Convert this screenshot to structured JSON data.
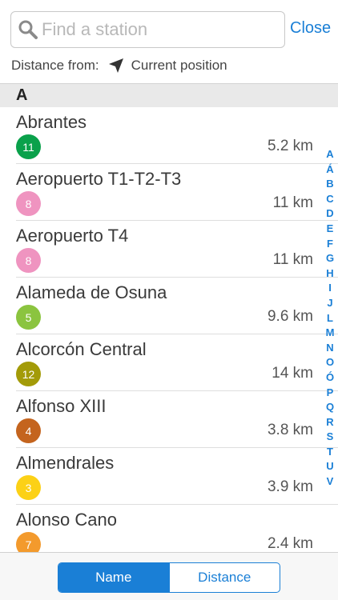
{
  "search": {
    "placeholder": "Find a station",
    "value": "",
    "icon": "search-icon"
  },
  "close_label": "Close",
  "distance_from": {
    "label": "Distance from:",
    "value": "Current position",
    "icon": "location-arrow-icon"
  },
  "section_header": "A",
  "stations": [
    {
      "name": "Abrantes",
      "line": "11",
      "color": "#0aa14b",
      "distance": "5.2 km"
    },
    {
      "name": "Aeropuerto T1-T2-T3",
      "line": "8",
      "color": "#ef94c0",
      "distance": "11 km"
    },
    {
      "name": "Aeropuerto T4",
      "line": "8",
      "color": "#ef94c0",
      "distance": "11 km"
    },
    {
      "name": "Alameda de Osuna",
      "line": "5",
      "color": "#8bc43f",
      "distance": "9.6 km"
    },
    {
      "name": "Alcorcón Central",
      "line": "12",
      "color": "#a39b08",
      "distance": "14 km"
    },
    {
      "name": "Alfonso XIII",
      "line": "4",
      "color": "#c4641e",
      "distance": "3.8 km"
    },
    {
      "name": "Almendrales",
      "line": "3",
      "color": "#fcd116",
      "distance": "3.9 km"
    },
    {
      "name": "Alonso Cano",
      "line": "7",
      "color": "#f39a2d",
      "distance": "2.4 km"
    }
  ],
  "index_letters": [
    "A",
    "Á",
    "B",
    "C",
    "D",
    "E",
    "F",
    "G",
    "H",
    "I",
    "J",
    "L",
    "M",
    "N",
    "O",
    "Ó",
    "P",
    "Q",
    "R",
    "S",
    "T",
    "U",
    "V"
  ],
  "sort": {
    "name_label": "Name",
    "distance_label": "Distance",
    "active": "Name"
  },
  "colors": {
    "accent": "#1a7fd6"
  }
}
